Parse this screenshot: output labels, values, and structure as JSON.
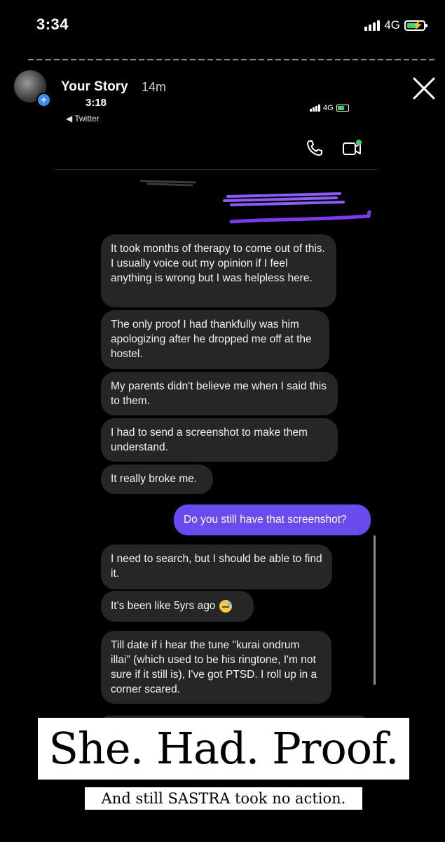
{
  "status_bar": {
    "time": "3:34",
    "network": "4G"
  },
  "story": {
    "name": "Your Story",
    "age": "14m",
    "avatar_plus": "+"
  },
  "inner_screenshot": {
    "time": "3:18",
    "back_label": "◀ Twitter",
    "network": "4G"
  },
  "messages": [
    {
      "side": "in",
      "text": "It took months of therapy to come out of this. I usually voice out my opinion if I feel anything is wrong but I was helpless here."
    },
    {
      "side": "in",
      "text": "The only proof I had thankfully was him apologizing after he dropped me off at the hostel."
    },
    {
      "side": "in",
      "text": "My parents didn't believe me when I said this to them."
    },
    {
      "side": "in",
      "text": "I had to send a screenshot to make them understand."
    },
    {
      "side": "in",
      "text": "It really broke me."
    },
    {
      "side": "out",
      "text": "Do you still have that screenshot?"
    },
    {
      "side": "in",
      "text": "I need to search, but I should be able to find it."
    },
    {
      "side": "in",
      "text": "It's been like 5yrs ago",
      "emoji": "downcast-sweat-face"
    },
    {
      "side": "in",
      "text": "Till date if i hear the tune \"kurai ondrum illai\" (which used to be his ringtone, I'm not sure if it still is), I've got PTSD. I roll up in a corner scared."
    }
  ],
  "captions": {
    "headline": "She. Had. Proof.",
    "subline": "And still SASTRA took no action."
  },
  "colors": {
    "incoming_bubble": "#262628",
    "outgoing_bubble": "#6a4bf0",
    "battery": "#3bd16f"
  },
  "icons": [
    "close-icon",
    "phone-icon",
    "video-call-icon",
    "signal-icon",
    "battery-icon"
  ]
}
